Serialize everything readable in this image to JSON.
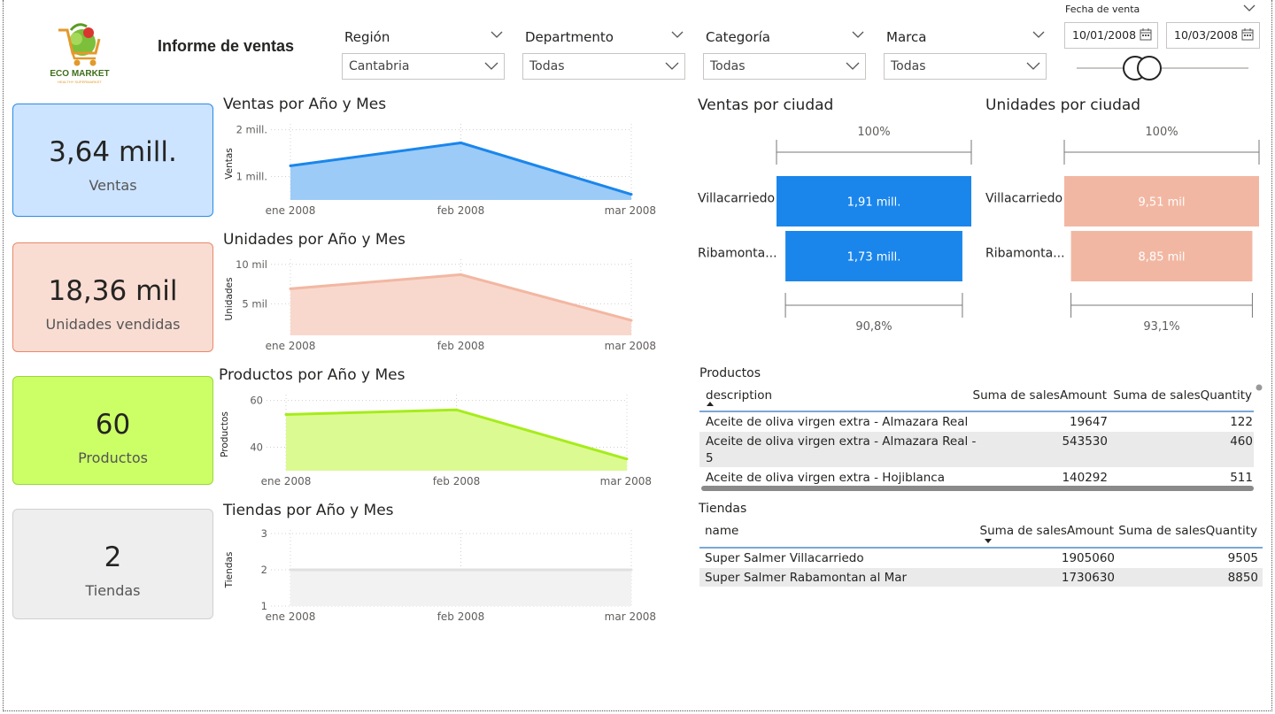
{
  "header": {
    "logo_text": "ECO MARKET",
    "logo_subtext": "HEALTHY SUPERMARKET",
    "title": "Informe de ventas"
  },
  "slicers": [
    {
      "title": "Región",
      "value": "Cantabria"
    },
    {
      "title": "Departmento",
      "value": "Todas"
    },
    {
      "title": "Categoría",
      "value": "Todas"
    },
    {
      "title": "Marca",
      "value": "Todas"
    }
  ],
  "date_slicer": {
    "title": "Fecha de venta",
    "start": "10/01/2008",
    "end": "10/03/2008"
  },
  "kpis": [
    {
      "value": "3,64 mill.",
      "label": "Ventas",
      "bg": "#cce4ff",
      "border": "#2a8be4"
    },
    {
      "value": "18,36 mil",
      "label": "Unidades vendidas",
      "bg": "#f9ddd3",
      "border": "#e8896b"
    },
    {
      "value": "60",
      "label": "Productos",
      "bg": "#ccff66",
      "border": "#9bd63b"
    },
    {
      "value": "2",
      "label": "Tiendas",
      "bg": "#eeeeee",
      "border": "#d0d0d0"
    }
  ],
  "chart_data": [
    {
      "type": "area",
      "title": "Ventas por Año y Mes",
      "ylabel": "Ventas",
      "categories": [
        "ene 2008",
        "feb 2008",
        "mar 2008"
      ],
      "values": [
        1230000,
        1720000,
        620000
      ],
      "yticks": [
        "2 mill.",
        "1 mill."
      ],
      "ytick_values": [
        2000000,
        1000000
      ],
      "ylim": [
        500000,
        2050000
      ],
      "line_color": "#1a86ec",
      "fill_color": "#9ccbf7"
    },
    {
      "type": "area",
      "title": "Unidades por Año y Mes",
      "ylabel": "Unidades",
      "categories": [
        "ene 2008",
        "feb 2008",
        "mar 2008"
      ],
      "values": [
        6900,
        8700,
        2900
      ],
      "yticks": [
        "10 mil",
        "5 mil"
      ],
      "ytick_values": [
        10000,
        5000
      ],
      "ylim": [
        1000,
        10200
      ],
      "line_color": "#f2b7a2",
      "fill_color": "#f8d8cd"
    },
    {
      "type": "area",
      "title": "Productos por Año y Mes",
      "ylabel": "Productos",
      "categories": [
        "ene 2008",
        "feb 2008",
        "mar 2008"
      ],
      "values": [
        54,
        56,
        35
      ],
      "yticks": [
        "60",
        "40"
      ],
      "ytick_values": [
        60,
        40
      ],
      "ylim": [
        30,
        61
      ],
      "line_color": "#a6ec1b",
      "fill_color": "#dcfa92"
    },
    {
      "type": "area",
      "title": "Tiendas por Año y Mes",
      "ylabel": "Tiendas",
      "categories": [
        "ene 2008",
        "feb 2008",
        "mar 2008"
      ],
      "values": [
        2,
        2,
        2
      ],
      "yticks": [
        "3",
        "2",
        "1"
      ],
      "ytick_values": [
        3,
        2,
        1
      ],
      "ylim": [
        1,
        3
      ],
      "line_color": "#e0e0e0",
      "fill_color": "#f2f2f2"
    },
    {
      "type": "bar",
      "title": "Ventas por ciudad",
      "categories": [
        "Villacarriedo",
        "Ribamonta..."
      ],
      "values": [
        1905060,
        1730630
      ],
      "data_labels": [
        "1,91 mill.",
        "1,73 mill."
      ],
      "top_label": "100%",
      "bottom_label": "90,8%",
      "color": "#1a86ec"
    },
    {
      "type": "bar",
      "title": "Unidades por ciudad",
      "categories": [
        "Villacarriedo",
        "Ribamonta..."
      ],
      "values": [
        9505,
        8850
      ],
      "data_labels": [
        "9,51 mil",
        "8,85 mil"
      ],
      "top_label": "100%",
      "bottom_label": "93,1%",
      "color": "#f2b7a2"
    }
  ],
  "productos_table": {
    "title": "Productos",
    "headers": [
      "description",
      "Suma de salesAmount",
      "Suma de salesQuantity"
    ],
    "rows": [
      [
        "Aceite de oliva virgen extra - Almazara Real",
        "19647",
        "122"
      ],
      [
        "Aceite de oliva virgen extra - Almazara Real -",
        "543530",
        "460"
      ],
      [
        "5",
        "",
        ""
      ],
      [
        "Aceite de oliva virgen extra - Hojiblanca",
        "140292",
        "511"
      ]
    ]
  },
  "tiendas_table": {
    "title": "Tiendas",
    "headers": [
      "name",
      "Suma de salesAmount",
      "Suma de salesQuantity"
    ],
    "rows": [
      [
        "Super Salmer Villacarriedo",
        "1905060",
        "9505"
      ],
      [
        "Super Salmer Rabamontan al Mar",
        "1730630",
        "8850"
      ]
    ]
  }
}
